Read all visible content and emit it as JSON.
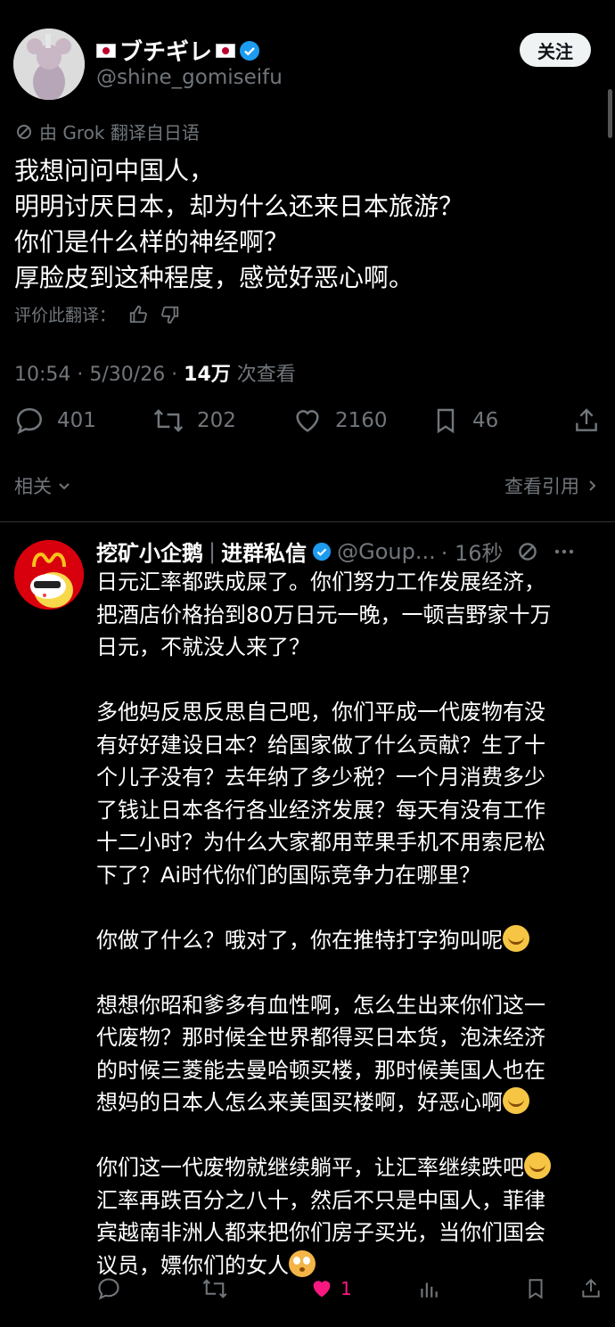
{
  "post": {
    "display_name": "ブチギレ",
    "handle": "@shine_gomiseifu",
    "follow_label": "关注",
    "translation_note": "由 Grok 翻译自日语",
    "text_lines": [
      "我想问问中国人，",
      "明明讨厌日本，却为什么还来日本旅游？",
      "你们是什么样的神经啊？",
      "厚脸皮到这种程度，感觉好恶心啊。"
    ],
    "rate_label": "评价此翻译：",
    "timestamp": "10:54 · 5/30/26 · ",
    "views_count": "14万",
    "views_label": " 次查看",
    "replies": "401",
    "reposts": "202",
    "likes": "2160",
    "bookmarks": "46",
    "related_label": "相关",
    "view_quotes_label": "查看引用"
  },
  "reply": {
    "display_name": "挖矿小企鹅",
    "separator": "|",
    "group_label": "进群私信",
    "handle": "@Goup...",
    "time": "· 16秒",
    "paragraphs": [
      [
        "日元汇率都跌成屎了。你们努力工作发展经济，",
        "把酒店价格抬到80万日元一晚，一顿吉野家十万",
        "日元，不就没人来了？"
      ],
      [
        "多他妈反思反思自己吧，你们平成一代废物有没",
        "有好好建设日本？给国家做了什么贡献？生了十",
        "个儿子没有？去年纳了多少税？一个月消费多少",
        "了钱让日本各行各业经济发展？每天有没有工作",
        "十二小时？为什么大家都用苹果手机不用索尼松",
        "下了？Ai时代你们的国际竞争力在哪里？"
      ],
      [
        "你做了什么？哦对了，你在推特打字狗叫呢"
      ],
      [
        "想想你昭和爹多有血性啊，怎么生出来你们这一",
        "代废物？那时候全世界都得买日本货，泡沫经济",
        "的时候三菱能去曼哈顿买楼，那时候美国人也在",
        "想妈的日本人怎么来美国买楼啊，好恶心啊"
      ],
      [
        "你们这一代废物就继续躺平，让汇率继续跌吧",
        "汇率再跌百分之八十，然后不只是中国人，菲律",
        "宾越南非洲人都来把你们房子买光，当你们国会",
        "议员，嫖你们的女人"
      ]
    ],
    "likes": "1"
  },
  "colors": {
    "background": "#000000",
    "text": "#e7e9ea",
    "muted": "#71767b",
    "verified": "#1d9bf0",
    "like_active": "#f91880"
  }
}
